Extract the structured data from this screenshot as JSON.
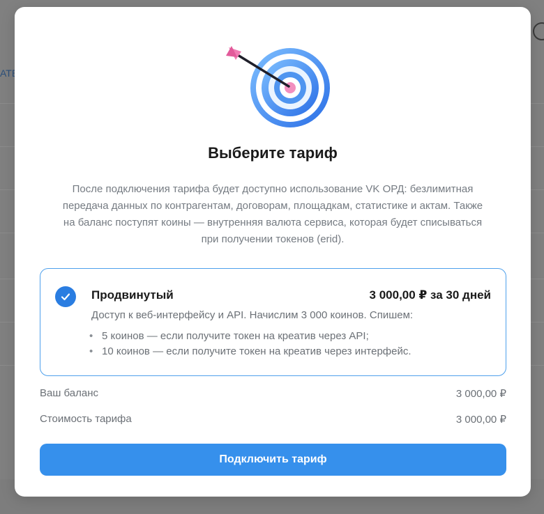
{
  "background": {
    "left_text": "ATE"
  },
  "modal": {
    "illustration_icon": "target-with-arrow-icon",
    "title": "Выберите тариф",
    "description": "После подключения тарифа будет доступно использование VK ОРД: безлимитная передача данных по контрагентам, договорам, площадкам, статистике и актам. Также на баланс поступят коины — внутренняя валюта сервиса, которая будет списываться при получении токенов (erid).",
    "tariff": {
      "selected": true,
      "name": "Продвинутый",
      "price": "3 000,00 ₽ за 30 дней",
      "description": "Доступ к веб-интерфейсу и API. Начислим 3 000 коинов. Спишем:",
      "items": [
        "5 коинов — если получите токен на креатив через API;",
        "10 коинов — если получите токен на креатив через интерфейс."
      ]
    },
    "balance": {
      "label": "Ваш баланс",
      "value": "3 000,00 ₽"
    },
    "cost": {
      "label": "Стоимость тарифа",
      "value": "3 000,00 ₽"
    },
    "button_label": "Подключить тариф"
  },
  "colors": {
    "accent": "#3690ec",
    "card_border": "#4ea0ec",
    "check": "#2a7de1",
    "overlay": "#808080"
  }
}
